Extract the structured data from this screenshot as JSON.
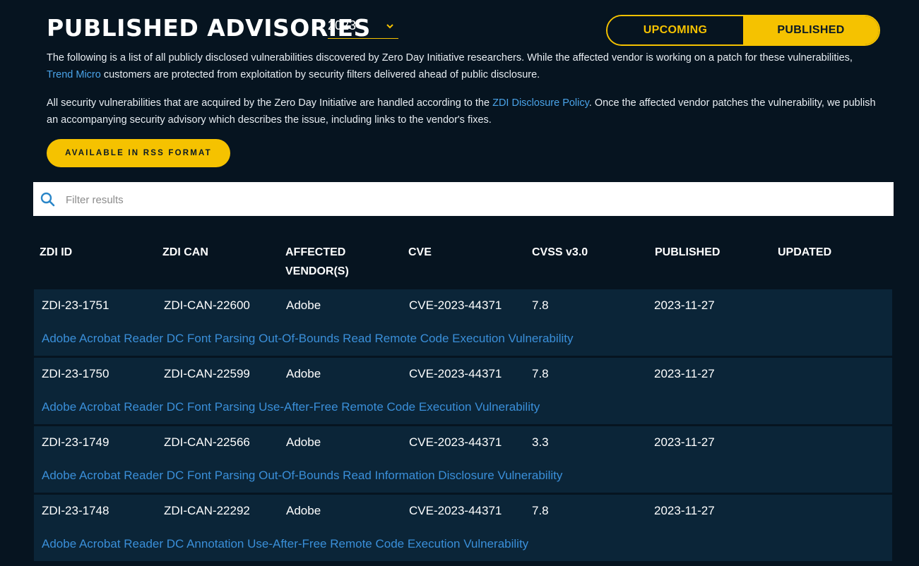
{
  "header": {
    "title": "PUBLISHED ADVISORIES",
    "year": "2023",
    "toggle": {
      "upcoming": "UPCOMING",
      "published": "PUBLISHED"
    }
  },
  "intro": {
    "p1_before": "The following is a list of all publicly disclosed vulnerabilities discovered by Zero Day Initiative researchers. While the affected vendor is working on a patch for these vulnerabilities, ",
    "p1_link": "Trend Micro",
    "p1_after": " customers are protected from exploitation by security filters delivered ahead of public disclosure.",
    "p2_before": "All security vulnerabilities that are acquired by the Zero Day Initiative are handled according to the ",
    "p2_link": "ZDI Disclosure Policy",
    "p2_after": ". Once the affected vendor patches the vulnerability, we publish an accompanying security advisory which describes the issue, including links to the vendor's fixes."
  },
  "rss_button": "AVAILABLE IN RSS FORMAT",
  "filter": {
    "placeholder": "Filter results"
  },
  "table": {
    "headers": {
      "zdi_id": "ZDI ID",
      "zdi_can": "ZDI CAN",
      "vendor_line1": "AFFECTED",
      "vendor_line2": "VENDOR(S)",
      "cve": "CVE",
      "cvss": "CVSS v3.0",
      "published": "PUBLISHED",
      "updated": "UPDATED"
    },
    "rows": [
      {
        "zdi_id": "ZDI-23-1751",
        "zdi_can": "ZDI-CAN-22600",
        "vendor": "Adobe",
        "cve": "CVE-2023-44371",
        "cvss": "7.8",
        "published": "2023-11-27",
        "updated": "",
        "title": "Adobe Acrobat Reader DC Font Parsing Out-Of-Bounds Read Remote Code Execution Vulnerability"
      },
      {
        "zdi_id": "ZDI-23-1750",
        "zdi_can": "ZDI-CAN-22599",
        "vendor": "Adobe",
        "cve": "CVE-2023-44371",
        "cvss": "7.8",
        "published": "2023-11-27",
        "updated": "",
        "title": "Adobe Acrobat Reader DC Font Parsing Use-After-Free Remote Code Execution Vulnerability"
      },
      {
        "zdi_id": "ZDI-23-1749",
        "zdi_can": "ZDI-CAN-22566",
        "vendor": "Adobe",
        "cve": "CVE-2023-44371",
        "cvss": "3.3",
        "published": "2023-11-27",
        "updated": "",
        "title": "Adobe Acrobat Reader DC Font Parsing Out-Of-Bounds Read Information Disclosure Vulnerability"
      },
      {
        "zdi_id": "ZDI-23-1748",
        "zdi_can": "ZDI-CAN-22292",
        "vendor": "Adobe",
        "cve": "CVE-2023-44371",
        "cvss": "7.8",
        "published": "2023-11-27",
        "updated": "",
        "title": "Adobe Acrobat Reader DC Annotation Use-After-Free Remote Code Execution Vulnerability"
      }
    ]
  },
  "colors": {
    "accent": "#f5c200",
    "link": "#3a8fd9",
    "background": "#061420",
    "row_bg": "#0b2538"
  }
}
